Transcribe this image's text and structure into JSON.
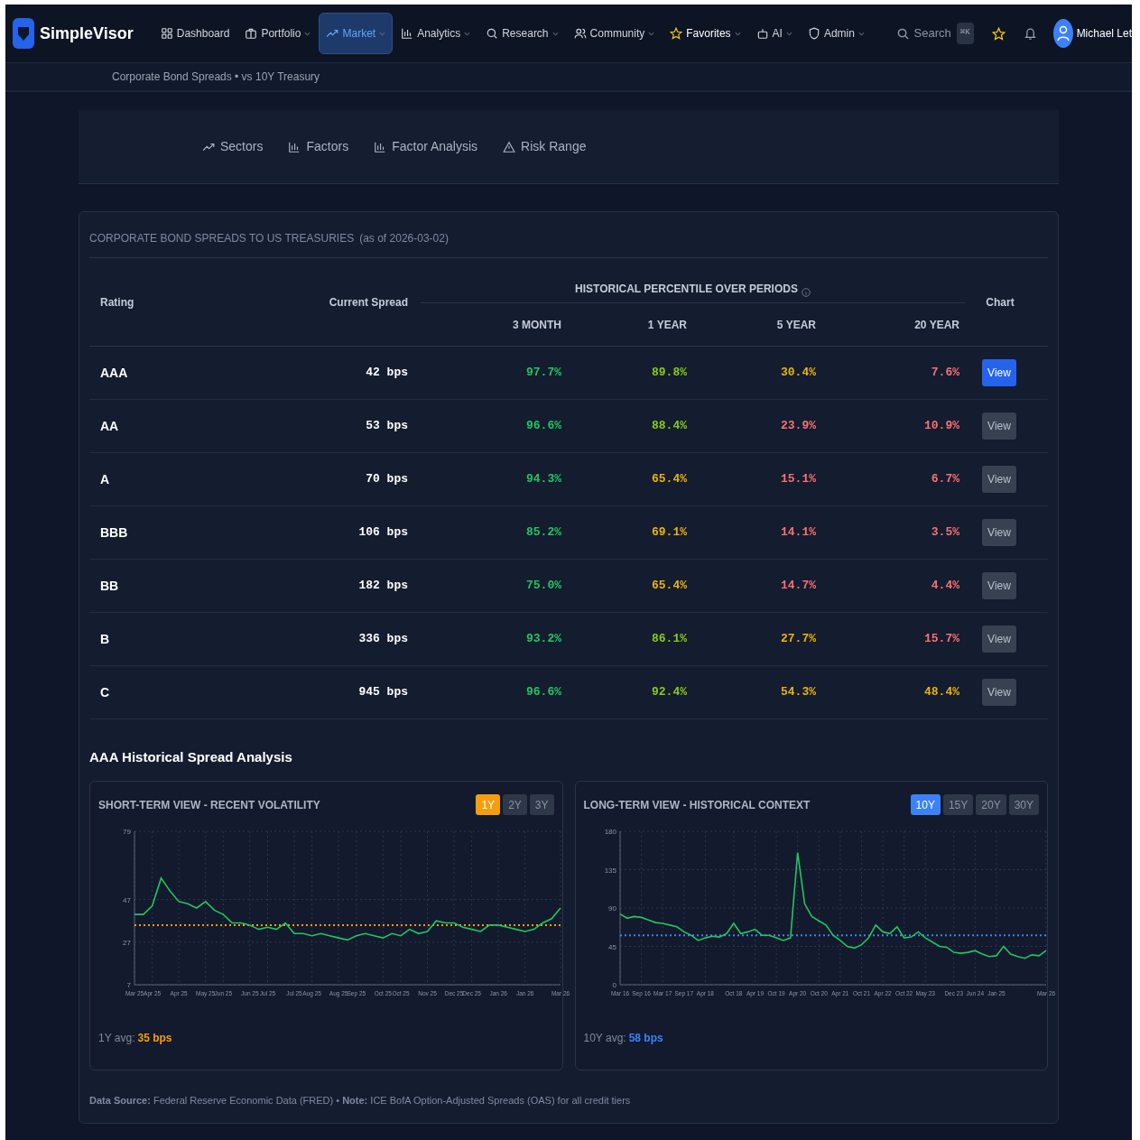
{
  "brand": {
    "name": "SimpleVisor"
  },
  "nav": [
    {
      "label": "Dashboard",
      "dropdown": false,
      "selected": false,
      "highlight": false
    },
    {
      "label": "Portfolio",
      "dropdown": true,
      "selected": false,
      "highlight": false
    },
    {
      "label": "Market",
      "dropdown": true,
      "selected": true,
      "highlight": false
    },
    {
      "label": "Analytics",
      "dropdown": true,
      "selected": false,
      "highlight": false
    },
    {
      "label": "Research",
      "dropdown": true,
      "selected": false,
      "highlight": false
    },
    {
      "label": "Community",
      "dropdown": true,
      "selected": false,
      "highlight": false
    },
    {
      "label": "Favorites",
      "dropdown": true,
      "selected": false,
      "highlight": true
    },
    {
      "label": "AI",
      "dropdown": true,
      "selected": false,
      "highlight": false
    },
    {
      "label": "Admin",
      "dropdown": true,
      "selected": false,
      "highlight": false
    }
  ],
  "search": {
    "placeholder": "Search",
    "shortcut": "⌘K"
  },
  "user": {
    "name": "Michael Let"
  },
  "breadcrumb": "Corporate Bond Spreads • vs 10Y Treasury",
  "tabs": [
    {
      "label": "Sectors",
      "selected": false
    },
    {
      "label": "Factors",
      "selected": false
    },
    {
      "label": "Factor Analysis",
      "selected": false
    },
    {
      "label": "Risk Range",
      "selected": false
    }
  ],
  "table": {
    "title": "CORPORATE BOND SPREADS TO US TREASURIES",
    "as_of": "(as of 2026-03-02)",
    "group_heading": "HISTORICAL PERCENTILE OVER PERIODS",
    "columns": [
      "Rating",
      "Current Spread",
      "3 MONTH",
      "1 YEAR",
      "5 YEAR",
      "20 YEAR",
      "Chart"
    ],
    "rows": [
      {
        "rating": "AAA",
        "spread": "42 bps",
        "percentiles": [
          {
            "value": "97.7%",
            "color": "#22c55e"
          },
          {
            "value": "89.8%",
            "color": "#84cc16"
          },
          {
            "value": "30.4%",
            "color": "#eab308"
          },
          {
            "value": "7.6%",
            "color": "#f87171"
          }
        ],
        "button": "View",
        "selected": true
      },
      {
        "rating": "AA",
        "spread": "53 bps",
        "percentiles": [
          {
            "value": "96.6%",
            "color": "#22c55e"
          },
          {
            "value": "88.4%",
            "color": "#84cc16"
          },
          {
            "value": "23.9%",
            "color": "#f87171"
          },
          {
            "value": "10.9%",
            "color": "#f87171"
          }
        ],
        "button": "View",
        "selected": false
      },
      {
        "rating": "A",
        "spread": "70 bps",
        "percentiles": [
          {
            "value": "94.3%",
            "color": "#22c55e"
          },
          {
            "value": "65.4%",
            "color": "#eab308"
          },
          {
            "value": "15.1%",
            "color": "#f87171"
          },
          {
            "value": "6.7%",
            "color": "#f87171"
          }
        ],
        "button": "View",
        "selected": false
      },
      {
        "rating": "BBB",
        "spread": "106 bps",
        "percentiles": [
          {
            "value": "85.2%",
            "color": "#22c55e"
          },
          {
            "value": "69.1%",
            "color": "#eab308"
          },
          {
            "value": "14.1%",
            "color": "#f87171"
          },
          {
            "value": "3.5%",
            "color": "#f87171"
          }
        ],
        "button": "View",
        "selected": false
      },
      {
        "rating": "BB",
        "spread": "182 bps",
        "percentiles": [
          {
            "value": "75.0%",
            "color": "#22c55e"
          },
          {
            "value": "65.4%",
            "color": "#eab308"
          },
          {
            "value": "14.7%",
            "color": "#f87171"
          },
          {
            "value": "4.4%",
            "color": "#f87171"
          }
        ],
        "button": "View",
        "selected": false
      },
      {
        "rating": "B",
        "spread": "336 bps",
        "percentiles": [
          {
            "value": "93.2%",
            "color": "#22c55e"
          },
          {
            "value": "86.1%",
            "color": "#84cc16"
          },
          {
            "value": "27.7%",
            "color": "#eab308"
          },
          {
            "value": "15.7%",
            "color": "#f87171"
          }
        ],
        "button": "View",
        "selected": false
      },
      {
        "rating": "C",
        "spread": "945 bps",
        "percentiles": [
          {
            "value": "96.6%",
            "color": "#22c55e"
          },
          {
            "value": "92.4%",
            "color": "#84cc16"
          },
          {
            "value": "54.3%",
            "color": "#eab308"
          },
          {
            "value": "48.4%",
            "color": "#eab308"
          }
        ],
        "button": "View",
        "selected": false
      }
    ]
  },
  "analysis": {
    "title": "AAA Historical Spread Analysis",
    "panels": [
      {
        "title": "SHORT-TERM VIEW - RECENT VOLATILITY",
        "color": "#f59e0b",
        "ranges": [
          {
            "label": "1Y",
            "selected": true
          },
          {
            "label": "2Y",
            "selected": false
          },
          {
            "label": "3Y",
            "selected": false
          }
        ],
        "avg_label": "1Y avg:",
        "avg_value": "35 bps",
        "chart_data": {
          "type": "line",
          "categories": [
            "Mar 25",
            null,
            "Apr 25",
            null,
            null,
            "Apr 25",
            null,
            null,
            "May 25",
            null,
            "Jun 25",
            null,
            null,
            "Jun 25",
            null,
            "Jul 25",
            null,
            null,
            "Jul 25",
            null,
            "Aug 25",
            null,
            null,
            "Aug 25",
            null,
            "Sep 25",
            null,
            null,
            "Oct 25",
            null,
            "Oct 25",
            null,
            null,
            "Nov 25",
            null,
            null,
            "Dec 25",
            null,
            "Dec 25",
            null,
            null,
            "Jan 26",
            null,
            null,
            "Jan 26",
            null,
            null,
            null,
            "Mar 26"
          ],
          "series": [
            {
              "color": "#22c55e",
              "line_style": "solid",
              "values": [
                40,
                40,
                44,
                57,
                51,
                46,
                45,
                43,
                46,
                42,
                40,
                36,
                36,
                35,
                33,
                34,
                33,
                36,
                31,
                31,
                30,
                31,
                30,
                29,
                28,
                30,
                31,
                30,
                29,
                31,
                30,
                33,
                31,
                32,
                37,
                36,
                36,
                34,
                33,
                32,
                35,
                35,
                34,
                33,
                32,
                33,
                36,
                38,
                43
              ]
            },
            {
              "color": "#f59e0b",
              "line_style": "dotted",
              "values": [
                35,
                35,
                35,
                35,
                35,
                35,
                35,
                35,
                35,
                35,
                35,
                35,
                35,
                35,
                35,
                35,
                35,
                35,
                35,
                35,
                35,
                35,
                35,
                35,
                35,
                35,
                35,
                35,
                35,
                35,
                35,
                35,
                35,
                35,
                35,
                35,
                35,
                35,
                35,
                35,
                35,
                35,
                35,
                35,
                35,
                35,
                35,
                35,
                35
              ]
            }
          ],
          "ylim": [
            7,
            79
          ],
          "yticks": [
            7,
            27,
            47,
            79
          ],
          "grid": true
        }
      },
      {
        "title": "LONG-TERM VIEW - HISTORICAL CONTEXT",
        "color": "#3b82f6",
        "ranges": [
          {
            "label": "10Y",
            "selected": true
          },
          {
            "label": "15Y",
            "selected": false
          },
          {
            "label": "20Y",
            "selected": false
          },
          {
            "label": "30Y",
            "selected": false
          }
        ],
        "avg_label": "10Y avg:",
        "avg_value": "58 bps",
        "chart_data": {
          "type": "line",
          "categories": [
            "Mar 16",
            null,
            null,
            "Sep 16",
            null,
            null,
            "Mar 17",
            null,
            null,
            "Sep 17",
            null,
            null,
            "Apr 18",
            null,
            null,
            null,
            "Oct 18",
            null,
            null,
            "Apr 19",
            null,
            null,
            "Oct 19",
            null,
            null,
            "Apr 20",
            null,
            null,
            "Oct 20",
            null,
            null,
            "Apr 21",
            null,
            null,
            "Oct 21",
            null,
            null,
            "Apr 22",
            null,
            null,
            "Oct 22",
            null,
            null,
            "May 23",
            null,
            null,
            null,
            "Dec 23",
            null,
            null,
            "Jun 24",
            null,
            null,
            "Jan 25",
            null,
            null,
            null,
            null,
            null,
            null,
            "Mar 26"
          ],
          "series": [
            {
              "color": "#22c55e",
              "line_style": "solid",
              "values": [
                83,
                78,
                80,
                79,
                76,
                73,
                72,
                70,
                68,
                62,
                58,
                52,
                55,
                57,
                56,
                60,
                72,
                60,
                62,
                65,
                58,
                58,
                55,
                52,
                55,
                155,
                95,
                80,
                75,
                70,
                58,
                52,
                45,
                43,
                47,
                55,
                70,
                62,
                60,
                68,
                55,
                56,
                62,
                55,
                50,
                45,
                44,
                38,
                37,
                38,
                40,
                36,
                33,
                34,
                45,
                36,
                33,
                31,
                35,
                34,
                40
              ]
            },
            {
              "color": "#3b82f6",
              "line_style": "dotted",
              "values": [
                58,
                58,
                58,
                58,
                58,
                58,
                58,
                58,
                58,
                58,
                58,
                58,
                58,
                58,
                58,
                58,
                58,
                58,
                58,
                58,
                58,
                58,
                58,
                58,
                58,
                58,
                58,
                58,
                58,
                58,
                58,
                58,
                58,
                58,
                58,
                58,
                58,
                58,
                58,
                58,
                58,
                58,
                58,
                58,
                58,
                58,
                58,
                58,
                58,
                58,
                58,
                58,
                58,
                58,
                58,
                58,
                58,
                58,
                58,
                58,
                58
              ]
            }
          ],
          "ylim": [
            0,
            180
          ],
          "yticks": [
            0,
            45,
            90,
            135,
            180
          ],
          "grid": true
        }
      }
    ]
  },
  "footer": "**Data Source:** Federal Reserve Economic Data (FRED) • **Note:** ICE BofA Option-Adjusted Spreads (OAS) for all credit tiers"
}
